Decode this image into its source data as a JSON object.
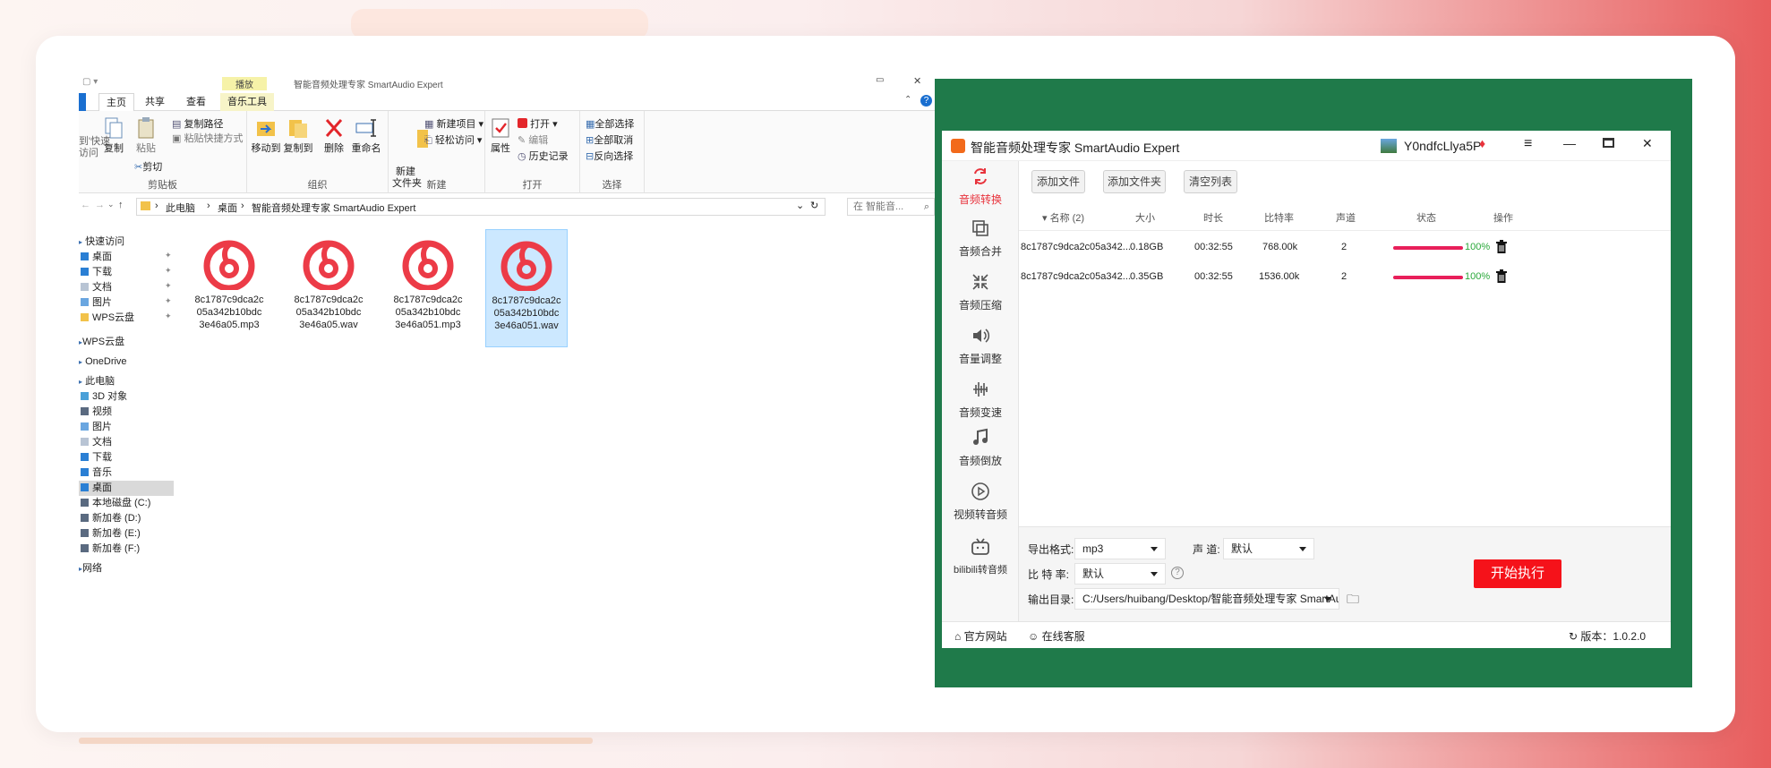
{
  "explorer": {
    "window_title": "智能音频处理专家 SmartAudio Expert",
    "context_tab": "播放",
    "tabs": [
      "主页",
      "共享",
      "查看",
      "音乐工具"
    ],
    "ribbon": {
      "clipboard": {
        "group": "剪贴板",
        "pin_partial": "到'快速\n访问",
        "copy": "复制",
        "paste": "粘贴",
        "copy_path": "复制路径",
        "paste_shortcut": "粘贴快捷方式",
        "cut": "剪切"
      },
      "organize": {
        "group": "组织",
        "move_to": "移动到",
        "copy_to": "复制到",
        "delete": "删除",
        "rename": "重命名"
      },
      "new": {
        "group": "新建",
        "new_folder": "新建\n文件夹",
        "new_item": "新建项目",
        "easy_access": "轻松访问"
      },
      "open": {
        "group": "打开",
        "properties": "属性",
        "open": "打开",
        "edit": "编辑",
        "history": "历史记录"
      },
      "select": {
        "group": "选择",
        "select_all": "全部选择",
        "select_none": "全部取消",
        "invert": "反向选择"
      }
    },
    "breadcrumb": [
      "此电脑",
      "桌面",
      "智能音频处理专家 SmartAudio Expert"
    ],
    "search_placeholder": "在 智能音...",
    "nav": [
      "快速访问",
      "桌面",
      "下载",
      "文档",
      "图片",
      "WPS云盘",
      "WPS云盘",
      "OneDrive",
      "此电脑",
      "3D 对象",
      "视频",
      "图片",
      "文档",
      "下载",
      "音乐",
      "桌面",
      "本地磁盘 (C:)",
      "新加卷 (D:)",
      "新加卷 (E:)",
      "新加卷 (F:)",
      "网络"
    ],
    "files": [
      {
        "line1": "8c1787c9dca2c",
        "line2": "05a342b10bdc",
        "line3": "3e46a05.mp3"
      },
      {
        "line1": "8c1787c9dca2c",
        "line2": "05a342b10bdc",
        "line3": "3e46a05.wav"
      },
      {
        "line1": "8c1787c9dca2c",
        "line2": "05a342b10bdc",
        "line3": "3e46a051.mp3"
      },
      {
        "line1": "8c1787c9dca2c",
        "line2": "05a342b10bdc",
        "line3": "3e46a051.wav"
      }
    ]
  },
  "app": {
    "title": "智能音频处理专家 SmartAudio Expert",
    "user": "Y0ndfcLlya5P",
    "sidebar": [
      "音频转换",
      "音频合并",
      "音频压缩",
      "音量调整",
      "音频变速",
      "音频倒放",
      "视频转音频",
      "bilibili转音频"
    ],
    "toolbar": {
      "add_file": "添加文件",
      "add_folder": "添加文件夹",
      "clear_list": "清空列表"
    },
    "columns": [
      "名称 (2)",
      "大小",
      "时长",
      "比特率",
      "声道",
      "状态",
      "操作"
    ],
    "rows": [
      {
        "name": "8c1787c9dca2c05a342...",
        "size": "0.18GB",
        "duration": "00:32:55",
        "bitrate": "768.00k",
        "channels": "2",
        "progress": 1.0,
        "status": "100%"
      },
      {
        "name": "8c1787c9dca2c05a342...",
        "size": "0.35GB",
        "duration": "00:32:55",
        "bitrate": "1536.00k",
        "channels": "2",
        "progress": 1.0,
        "status": "100%"
      }
    ],
    "settings": {
      "format_label": "导出格式:",
      "format_value": "mp3",
      "channel_label": "声 道:",
      "channel_value": "默认",
      "bitrate_label": "比 特 率:",
      "bitrate_value": "默认",
      "output_label": "输出目录:",
      "output_value": "C:/Users/huibang/Desktop/智能音频处理专家 SmartAudio",
      "start": "开始执行"
    },
    "footer": {
      "website": "官方网站",
      "support": "在线客服",
      "version": "版本：1.0.2.0"
    },
    "colors": {
      "accent": "#f5121a",
      "progress": "#e81f5a",
      "success": "#2aa83a",
      "frame": "#1f7a4a"
    }
  }
}
